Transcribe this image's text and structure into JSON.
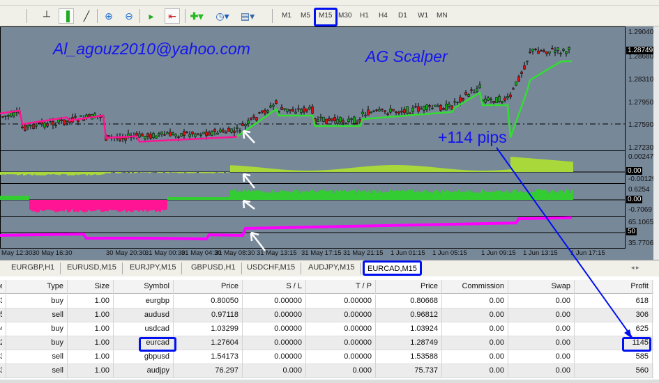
{
  "toolbar": {
    "icons": [
      "bar-chart-icon",
      "candlestick-icon",
      "line-chart-icon",
      "zoom-in-icon",
      "zoom-out-icon",
      "autoscroll-icon",
      "chart-shift-icon",
      "indicators-icon",
      "periods-icon",
      "templates-icon"
    ],
    "timeframes": [
      "M1",
      "M5",
      "M15",
      "M30",
      "H1",
      "H4",
      "D1",
      "W1",
      "MN"
    ],
    "active_timeframe": "M15"
  },
  "chart": {
    "annotation_email": "Al_agouz2010@yahoo.com",
    "annotation_title": "AG Scalper",
    "annotation_pips": "+114 pips",
    "price_scale": [
      "1.29040",
      "1.28680",
      "1.28310",
      "1.27950",
      "1.27590",
      "1.27230"
    ],
    "current_price": "1.28749",
    "ind1_scale": [
      "0.002473",
      "0.00",
      "-0.00129"
    ],
    "ind2_scale": [
      "0.6254",
      "0.00",
      "-0.7069"
    ],
    "ind3_scale": [
      "65.1065",
      "50",
      "35.7706"
    ],
    "time_axis": [
      "May 12:30",
      "30 May 16:30",
      "30 May 20:30",
      "31 May 00:30",
      "31 May 04:30",
      "31 May 08:30",
      "31 May 13:15",
      "31 May 17:15",
      "31 May 21:15",
      "1 Jun 01:15",
      "1 Jun 05:15",
      "1 Jun 09:15",
      "1 Jun 13:15",
      "1 Jun 17:15"
    ],
    "colors": {
      "background": "#778899",
      "ma_down": "#ff1493",
      "ma_up": "#33dd33",
      "hist1": "#a8d83a",
      "hist2_up": "#33cc33",
      "hist2_down": "#ff1493",
      "line3": "#ff00ff",
      "annotation": "#1515ee"
    }
  },
  "tabs": [
    "EURGBP,H1",
    "EURUSD,M15",
    "EURJPY,M15",
    "GBPUSD,H1",
    "USDCHF,M15",
    "AUDJPY,M15",
    "EURCAD,M15"
  ],
  "active_tab": "EURCAD,M15",
  "table": {
    "headers": [
      "e",
      "Type",
      "Size",
      "Symbol",
      "Price",
      "S / L",
      "T / P",
      "Price",
      "Commission",
      "Swap",
      "Profit"
    ],
    "rows": [
      [
        "3",
        "buy",
        "1.00",
        "eurgbp",
        "0.80050",
        "0.00000",
        "0.00000",
        "0.80668",
        "0.00",
        "0.00",
        "618"
      ],
      [
        "5",
        "sell",
        "1.00",
        "audusd",
        "0.97118",
        "0.00000",
        "0.00000",
        "0.96812",
        "0.00",
        "0.00",
        "306"
      ],
      [
        "4",
        "buy",
        "1.00",
        "usdcad",
        "1.03299",
        "0.00000",
        "0.00000",
        "1.03924",
        "0.00",
        "0.00",
        "625"
      ],
      [
        "2",
        "buy",
        "1.00",
        "eurcad",
        "1.27604",
        "0.00000",
        "0.00000",
        "1.28749",
        "0.00",
        "0.00",
        "1145"
      ],
      [
        "3",
        "sell",
        "1.00",
        "gbpusd",
        "1.54173",
        "0.00000",
        "0.00000",
        "1.53588",
        "0.00",
        "0.00",
        "585"
      ],
      [
        "3",
        "sell",
        "1.00",
        "audjpy",
        "76.297",
        "0.000",
        "0.000",
        "75.737",
        "0.00",
        "0.00",
        "560"
      ]
    ]
  }
}
